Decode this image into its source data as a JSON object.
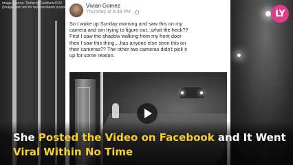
{
  "image_credit": [
    "Image Source: Twitter/@CarMuniz2016",
    "(Image used are for representation purpose only)"
  ],
  "logo": {
    "text": "LY"
  },
  "post": {
    "author": "Vivian Gomez",
    "timestamp": "Thursday at 8:38 PM",
    "privacy_separator": "·",
    "text_lines": [
      "So I woke up Sunday morning and saw this on my",
      "camera and am trying to figure out...what the heck??",
      "First I saw the shadow walking from my front door",
      "then I saw this thing....has anyone else seen this on",
      "their cameras?? The other two cameras didn't pick it",
      "up for some reason."
    ]
  },
  "headline": {
    "line1": [
      "She ",
      "Posted the Video on Facebook",
      " and It Went"
    ],
    "line2": [
      "Viral Within No Time"
    ]
  },
  "colors": {
    "highlight": "#f6cf2a",
    "logo_bg": "#e23b8a"
  }
}
